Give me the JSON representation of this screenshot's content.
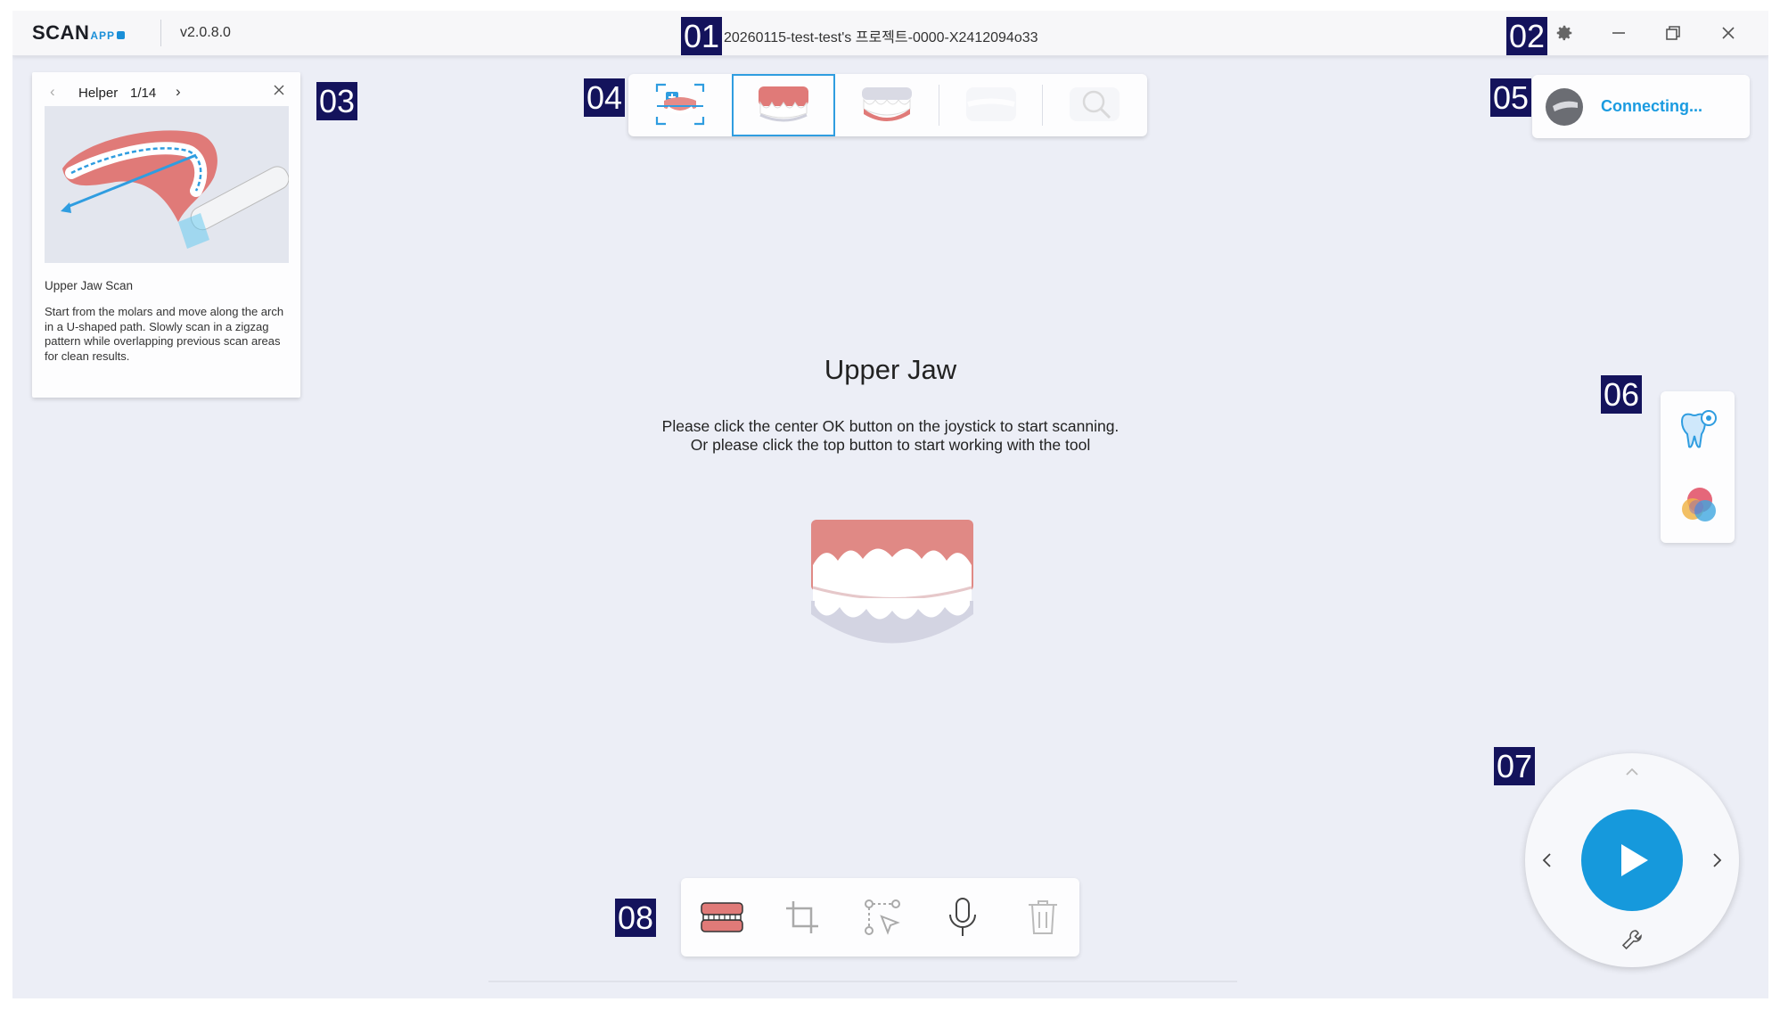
{
  "titlebar": {
    "logo": "SCAN",
    "logo_sub": "APP",
    "version": "v2.0.8.0",
    "project": "20260115-test-test's 프로젝트-0000-X2412094o33"
  },
  "badges": [
    "01",
    "02",
    "03",
    "04",
    "05",
    "06",
    "07",
    "08"
  ],
  "helper": {
    "title": "Helper",
    "page": "1/14",
    "scan_title": "Upper Jaw Scan",
    "description": "Start from the molars and move along the arch in a U-shaped path. Slowly scan in a zigzag pattern while overlapping previous scan areas for clean results."
  },
  "steps": [
    {
      "name": "pre-op-scan",
      "icon": "add-scan-icon",
      "state": "enabled"
    },
    {
      "name": "upper-jaw",
      "icon": "upper-jaw-icon",
      "state": "selected"
    },
    {
      "name": "lower-jaw",
      "icon": "lower-jaw-icon",
      "state": "enabled"
    },
    {
      "name": "bite",
      "icon": "bite-icon",
      "state": "disabled"
    },
    {
      "name": "analysis",
      "icon": "magnifier-icon",
      "state": "disabled"
    }
  ],
  "connection": {
    "status": "Connecting..."
  },
  "main": {
    "title": "Upper Jaw",
    "line1": "Please click the center OK button on the joystick to start scanning.",
    "line2": "Or please click the top button to start working with the tool"
  },
  "side_tools": [
    "tooth-settings-icon",
    "color-palette-icon"
  ],
  "bottom_tools": [
    "jaw-model-icon",
    "crop-icon",
    "select-region-icon",
    "microphone-icon",
    "trash-icon"
  ],
  "colors": {
    "accent": "#1699dc",
    "badge": "#14135c",
    "background": "#eceef6"
  }
}
